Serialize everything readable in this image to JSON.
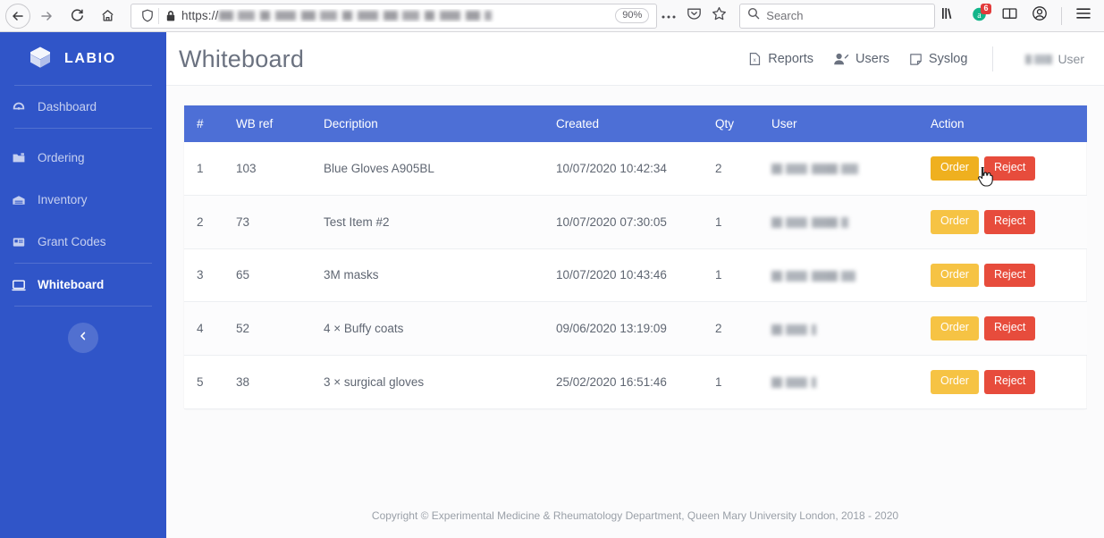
{
  "browser": {
    "back_icon": "back-arrow-icon",
    "forward_icon": "forward-arrow-icon",
    "reload_icon": "reload-icon",
    "home_icon": "home-icon",
    "url_scheme": "https://",
    "url_redacted": true,
    "zoom_level": "90%",
    "shield_icon": "tracking-protection-shield-icon",
    "lock_icon": "padlock-icon",
    "page_actions_icon": "ellipsis-icon",
    "pocket_icon": "pocket-icon",
    "bookmark_icon": "bookmark-star-icon",
    "search_placeholder": "Search",
    "search_icon": "search-icon",
    "library_icon": "library-icon",
    "extension_icon": "extension-icon",
    "extension_badge": "6",
    "sidebar_icon": "sidebar-toggle-icon",
    "account_icon": "account-icon",
    "menu_icon": "hamburger-menu-icon"
  },
  "sidebar": {
    "brand": "LABIO",
    "brand_icon": "cube-logo-icon",
    "items": [
      {
        "label": "Dashboard",
        "icon": "dashboard-icon",
        "active": false
      },
      {
        "label": "Ordering",
        "icon": "folder-plus-icon",
        "active": false
      },
      {
        "label": "Inventory",
        "icon": "warehouse-icon",
        "active": false
      },
      {
        "label": "Grant Codes",
        "icon": "id-card-icon",
        "active": false
      },
      {
        "label": "Whiteboard",
        "icon": "monitor-icon",
        "active": true
      }
    ],
    "collapse_icon": "chevron-left-icon",
    "background_color": "#3055c8"
  },
  "header": {
    "title": "Whiteboard",
    "nav": [
      {
        "label": "Reports",
        "icon": "excel-file-icon"
      },
      {
        "label": "Users",
        "icon": "user-edit-icon"
      },
      {
        "label": "Syslog",
        "icon": "sticky-note-icon"
      }
    ],
    "user_label": "User",
    "user_name_redacted": true
  },
  "table": {
    "columns": [
      "#",
      "WB ref",
      "Decription",
      "Created",
      "Qty",
      "User",
      "Action"
    ],
    "header_color": "#4d6fd6",
    "order_label": "Order",
    "reject_label": "Reject",
    "order_color": "#f6c344",
    "reject_color": "#e74c3c",
    "rows": [
      {
        "num": "1",
        "wb_ref": "103",
        "description": "Blue Gloves A905BL",
        "created": "10/07/2020 10:42:34",
        "qty": "2",
        "user_redacted": true,
        "user_blur_width": 97,
        "order_hover": true
      },
      {
        "num": "2",
        "wb_ref": "73",
        "description": "Test Item #2",
        "created": "10/07/2020 07:30:05",
        "qty": "1",
        "user_redacted": true,
        "user_blur_width": 86,
        "order_hover": false
      },
      {
        "num": "3",
        "wb_ref": "65",
        "description": "3M masks",
        "created": "10/07/2020 10:43:46",
        "qty": "1",
        "user_redacted": true,
        "user_blur_width": 94,
        "order_hover": false
      },
      {
        "num": "4",
        "wb_ref": "52",
        "description": "4 × Buffy coats",
        "created": "09/06/2020 13:19:09",
        "qty": "2",
        "user_redacted": true,
        "user_blur_width": 50,
        "order_hover": false
      },
      {
        "num": "5",
        "wb_ref": "38",
        "description": "3 × surgical gloves",
        "created": "25/02/2020 16:51:46",
        "qty": "1",
        "user_redacted": true,
        "user_blur_width": 50,
        "order_hover": false
      }
    ]
  },
  "footer": {
    "text": "Copyright © Experimental Medicine & Rheumatology Department, Queen Mary University London, 2018 - 2020"
  }
}
